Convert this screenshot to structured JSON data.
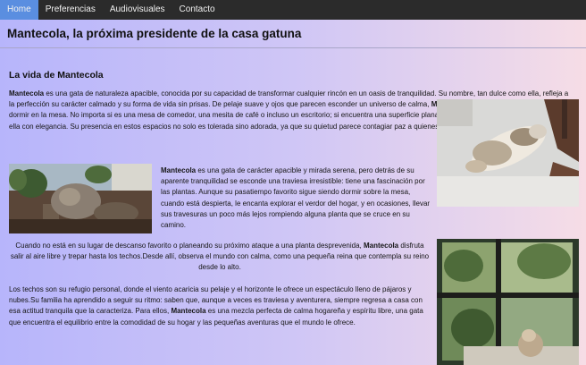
{
  "nav": {
    "items": [
      {
        "label": "Home",
        "active": true
      },
      {
        "label": "Preferencias",
        "active": false
      },
      {
        "label": "Audiovisuales",
        "active": false
      },
      {
        "label": "Contacto",
        "active": false
      }
    ]
  },
  "header": {
    "title": "Mantecola, la próxima presidente de la casa gatuna"
  },
  "article": {
    "subtitle": "La vida de Mantecola",
    "paragraph1": {
      "name": "Mantecola",
      "text1": " es una gata de naturaleza apacible, conocida por su capacidad de transformar cualquier rincón en un oasis de tranquilidad. Su nombre, tan dulce como ella, refleja a la perfección su carácter calmado y su forma de vida sin prisas. De pelaje suave y ojos que parecen esconder un universo de calma, ",
      "text2": " tiene una pasión muy particular: dormir en la mesa. No importa si es una mesa de comedor, una mesita de café o incluso un escritorio; si encuentra una superficie plana y cómoda, ",
      "text3": " se apodera de ella con elegancia. Su presencia en estos espacios no solo es tolerada sino adorada, ya que su quietud parece contagiar paz a quienes la rodean."
    },
    "paragraph2": {
      "name": "Mantecola",
      "text1": " es una gata de carácter apacible y mirada serena, pero detrás de su aparente tranquilidad se esconde una traviesa irresistible: tiene una fascinación por las plantas. Aunque su pasatiempo favorito sigue siendo dormir sobre la mesa, cuando está despierta, le encanta explorar el verdor del hogar, y en ocasiones, llevar sus travesuras un poco más lejos rompiendo alguna planta que se cruce en su camino."
    },
    "paragraph3": {
      "name": "Mantecola",
      "text1": "Cuando no está en su lugar de descanso favorito o planeando su próximo ataque a una planta desprevenida, ",
      "text2": " disfruta salir al aire libre y trepar hasta los techos.Desde allí, observa el mundo con calma, como una pequeña reina que contempla su reino desde lo alto."
    },
    "paragraph4": {
      "name": "Mantecola",
      "text1": "Los techos son su refugio personal, donde el viento acaricia su pelaje y el horizonte le ofrece un espectáculo lleno de pájaros y nubes.Su familia ha aprendido a seguir su ritmo: saben que, aunque a veces es traviesa y aventurera, siempre regresa a casa con esa actitud tranquila que la caracteriza. Para ellos, ",
      "text2": " es una mezcla perfecta de calma hogareña y espíritu libre, una gata que encuentra el equilibrio entre la comodidad de su hogar y las pequeñas aventuras que el mundo le ofrece."
    }
  },
  "images": [
    {
      "subject": "cat-sleeping-on-table"
    },
    {
      "subject": "cat-with-plants"
    },
    {
      "subject": "cat-by-window"
    }
  ]
}
